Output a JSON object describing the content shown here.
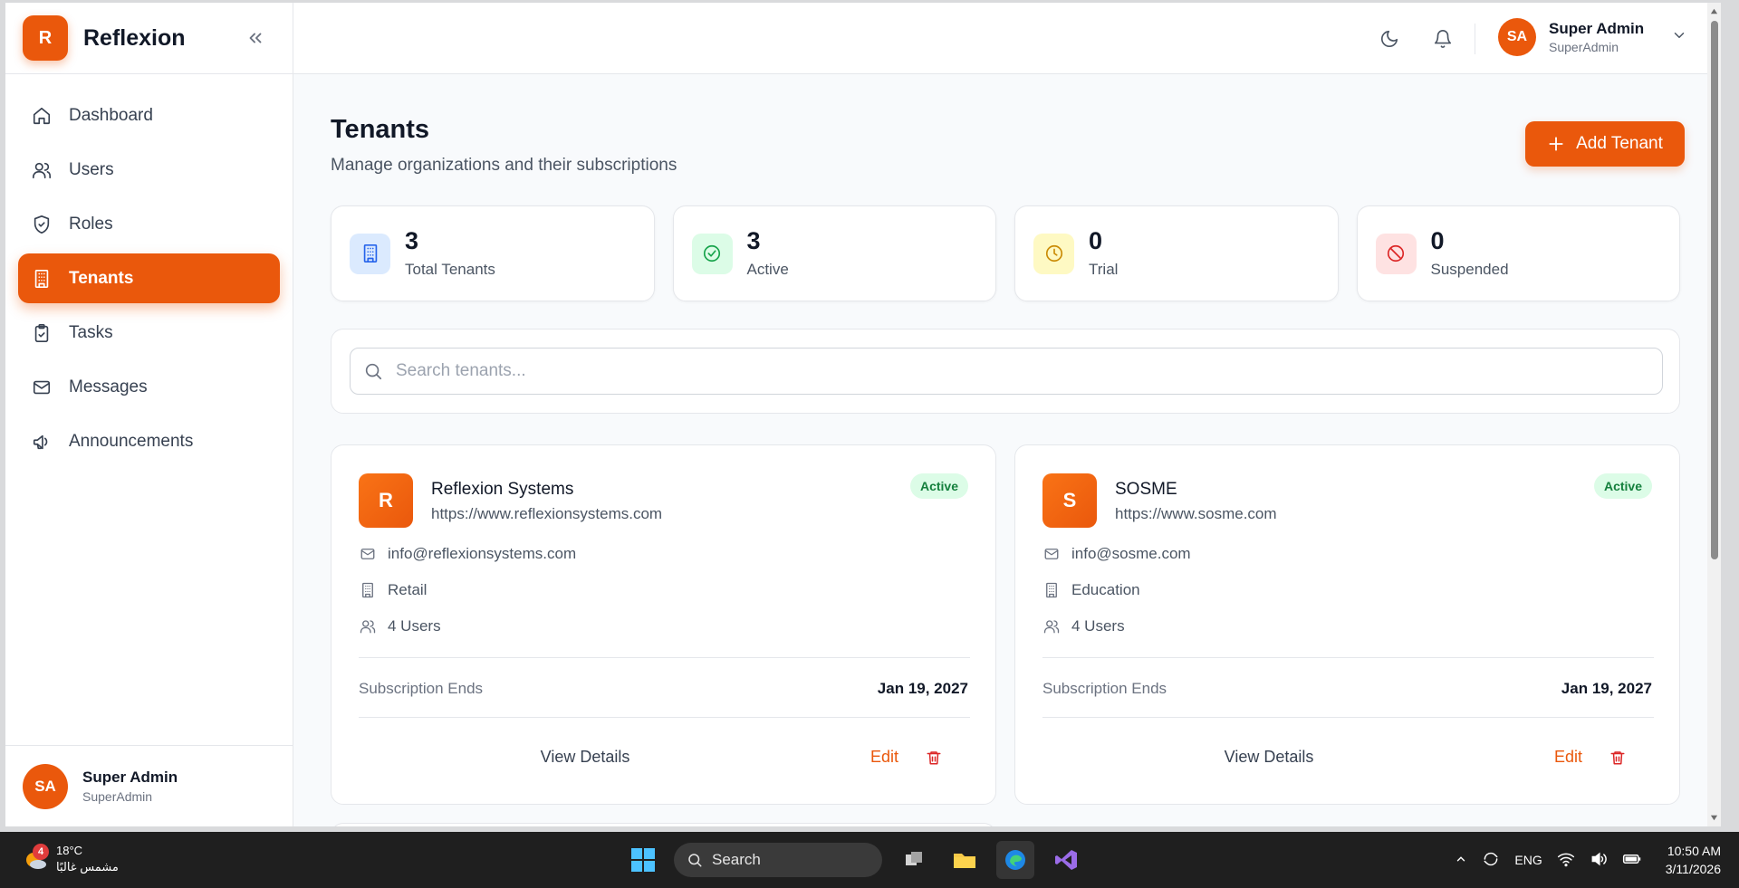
{
  "app": {
    "brand_initial": "R",
    "brand_name": "Reflexion",
    "accent_color": "#ea580c"
  },
  "sidebar": {
    "items": [
      {
        "label": "Dashboard",
        "icon": "home-icon"
      },
      {
        "label": "Users",
        "icon": "users-icon"
      },
      {
        "label": "Roles",
        "icon": "shield-icon"
      },
      {
        "label": "Tenants",
        "icon": "building-icon",
        "active": true
      },
      {
        "label": "Tasks",
        "icon": "clipboard-check-icon"
      },
      {
        "label": "Messages",
        "icon": "mail-icon"
      },
      {
        "label": "Announcements",
        "icon": "megaphone-icon"
      }
    ],
    "user": {
      "initials": "SA",
      "name": "Super Admin",
      "role": "SuperAdmin"
    }
  },
  "topbar": {
    "user": {
      "initials": "SA",
      "name": "Super Admin",
      "role": "SuperAdmin"
    }
  },
  "page": {
    "title": "Tenants",
    "subtitle": "Manage organizations and their subscriptions",
    "add_button": "Add Tenant"
  },
  "stats": [
    {
      "value": "3",
      "label": "Total Tenants",
      "icon": "building-icon",
      "color": "#2563eb",
      "bg": "#dbeafe"
    },
    {
      "value": "3",
      "label": "Active",
      "icon": "check-circle-icon",
      "color": "#16a34a",
      "bg": "#dcfce7"
    },
    {
      "value": "0",
      "label": "Trial",
      "icon": "clock-icon",
      "color": "#ca8a04",
      "bg": "#fef9c3"
    },
    {
      "value": "0",
      "label": "Suspended",
      "icon": "ban-icon",
      "color": "#dc2626",
      "bg": "#fee2e2"
    }
  ],
  "search": {
    "placeholder": "Search tenants..."
  },
  "tenants": [
    {
      "initial": "R",
      "name": "Reflexion Systems",
      "url": "https://www.reflexionsystems.com",
      "status": "Active",
      "email": "info@reflexionsystems.com",
      "industry": "Retail",
      "users": "4 Users",
      "subscription_label": "Subscription Ends",
      "subscription_end": "Jan 19, 2027",
      "view_label": "View Details",
      "edit_label": "Edit"
    },
    {
      "initial": "S",
      "name": "SOSME",
      "url": "https://www.sosme.com",
      "status": "Active",
      "email": "info@sosme.com",
      "industry": "Education",
      "users": "4 Users",
      "subscription_label": "Subscription Ends",
      "subscription_end": "Jan 19, 2027",
      "view_label": "View Details",
      "edit_label": "Edit"
    }
  ],
  "taskbar": {
    "weather_badge": "4",
    "temperature": "18°C",
    "weather_desc": "مشمس غالبًا",
    "search_label": "Search",
    "language": "ENG",
    "time": "10:50 AM",
    "date": "3/11/2026"
  }
}
